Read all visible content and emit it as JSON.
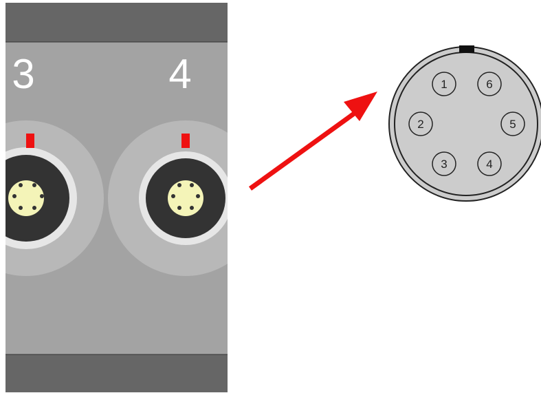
{
  "panel": {
    "ports": [
      {
        "label": "3"
      },
      {
        "label": "4"
      }
    ]
  },
  "pinout": {
    "pins": [
      {
        "label": "1"
      },
      {
        "label": "2"
      },
      {
        "label": "3"
      },
      {
        "label": "4"
      },
      {
        "label": "5"
      },
      {
        "label": "6"
      }
    ]
  },
  "colors": {
    "panel_body": "#a3a3a3",
    "panel_band": "#666666",
    "connector_ring": "#b8b8b8",
    "connector_bezel": "#e6e6e6",
    "connector_body": "#333333",
    "pin_insert": "#f4f4b8",
    "key_marker": "#ee1111",
    "arrow": "#ee1111",
    "pinout_face": "#cccccc"
  }
}
